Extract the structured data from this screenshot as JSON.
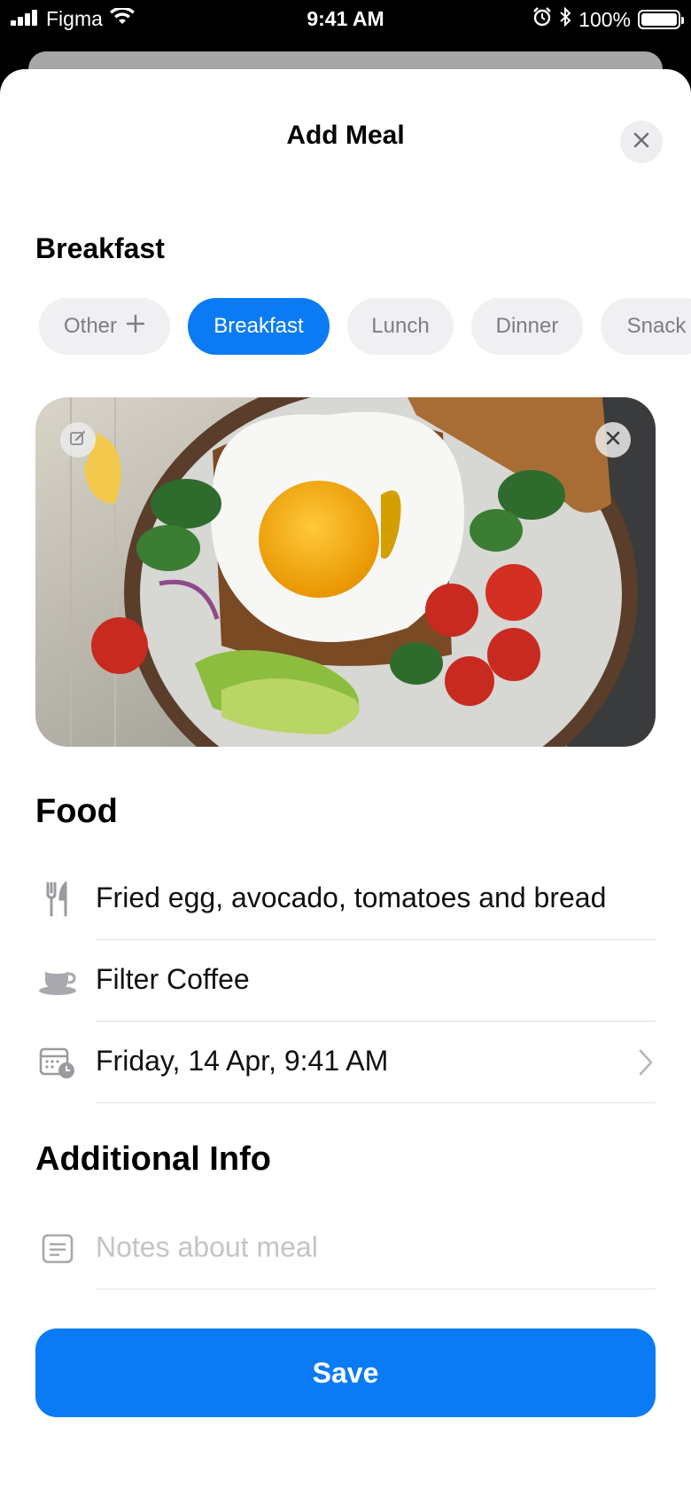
{
  "status_bar": {
    "carrier": "Figma",
    "time": "9:41 AM",
    "battery": "100%",
    "icons": [
      "signal-icon",
      "wifi-icon",
      "alarm-icon",
      "bluetooth-icon",
      "battery-icon"
    ]
  },
  "sheet": {
    "title": "Add Meal",
    "close_icon": "close-icon"
  },
  "meal_type": {
    "heading": "Breakfast",
    "chips": [
      {
        "label": "Other",
        "icon": "plus-icon",
        "selected": false
      },
      {
        "label": "Breakfast",
        "selected": true
      },
      {
        "label": "Lunch",
        "selected": false
      },
      {
        "label": "Dinner",
        "selected": false
      },
      {
        "label": "Snack",
        "selected": false
      }
    ]
  },
  "photo": {
    "description_icon": "meal-photo",
    "edit_icon": "edit-icon",
    "remove_icon": "close-icon"
  },
  "food": {
    "heading": "Food",
    "rows": [
      {
        "icon": "fork-knife-icon",
        "value": "Fried egg, avocado, tomatoes and bread"
      },
      {
        "icon": "coffee-cup-icon",
        "value": "Filter Coffee"
      },
      {
        "icon": "calendar-clock-icon",
        "value": "Friday, 14 Apr, 9:41 AM",
        "chevron": "chevron-right-icon"
      }
    ]
  },
  "additional_info": {
    "heading": "Additional Info",
    "notes_placeholder": "Notes about meal",
    "notes_value": "",
    "icon": "notes-icon"
  },
  "actions": {
    "save_label": "Save"
  },
  "colors": {
    "accent": "#0a7bf5",
    "chip_bg": "#f0f0f3",
    "chip_text": "#7d7d82",
    "placeholder": "#c4c4c8"
  }
}
